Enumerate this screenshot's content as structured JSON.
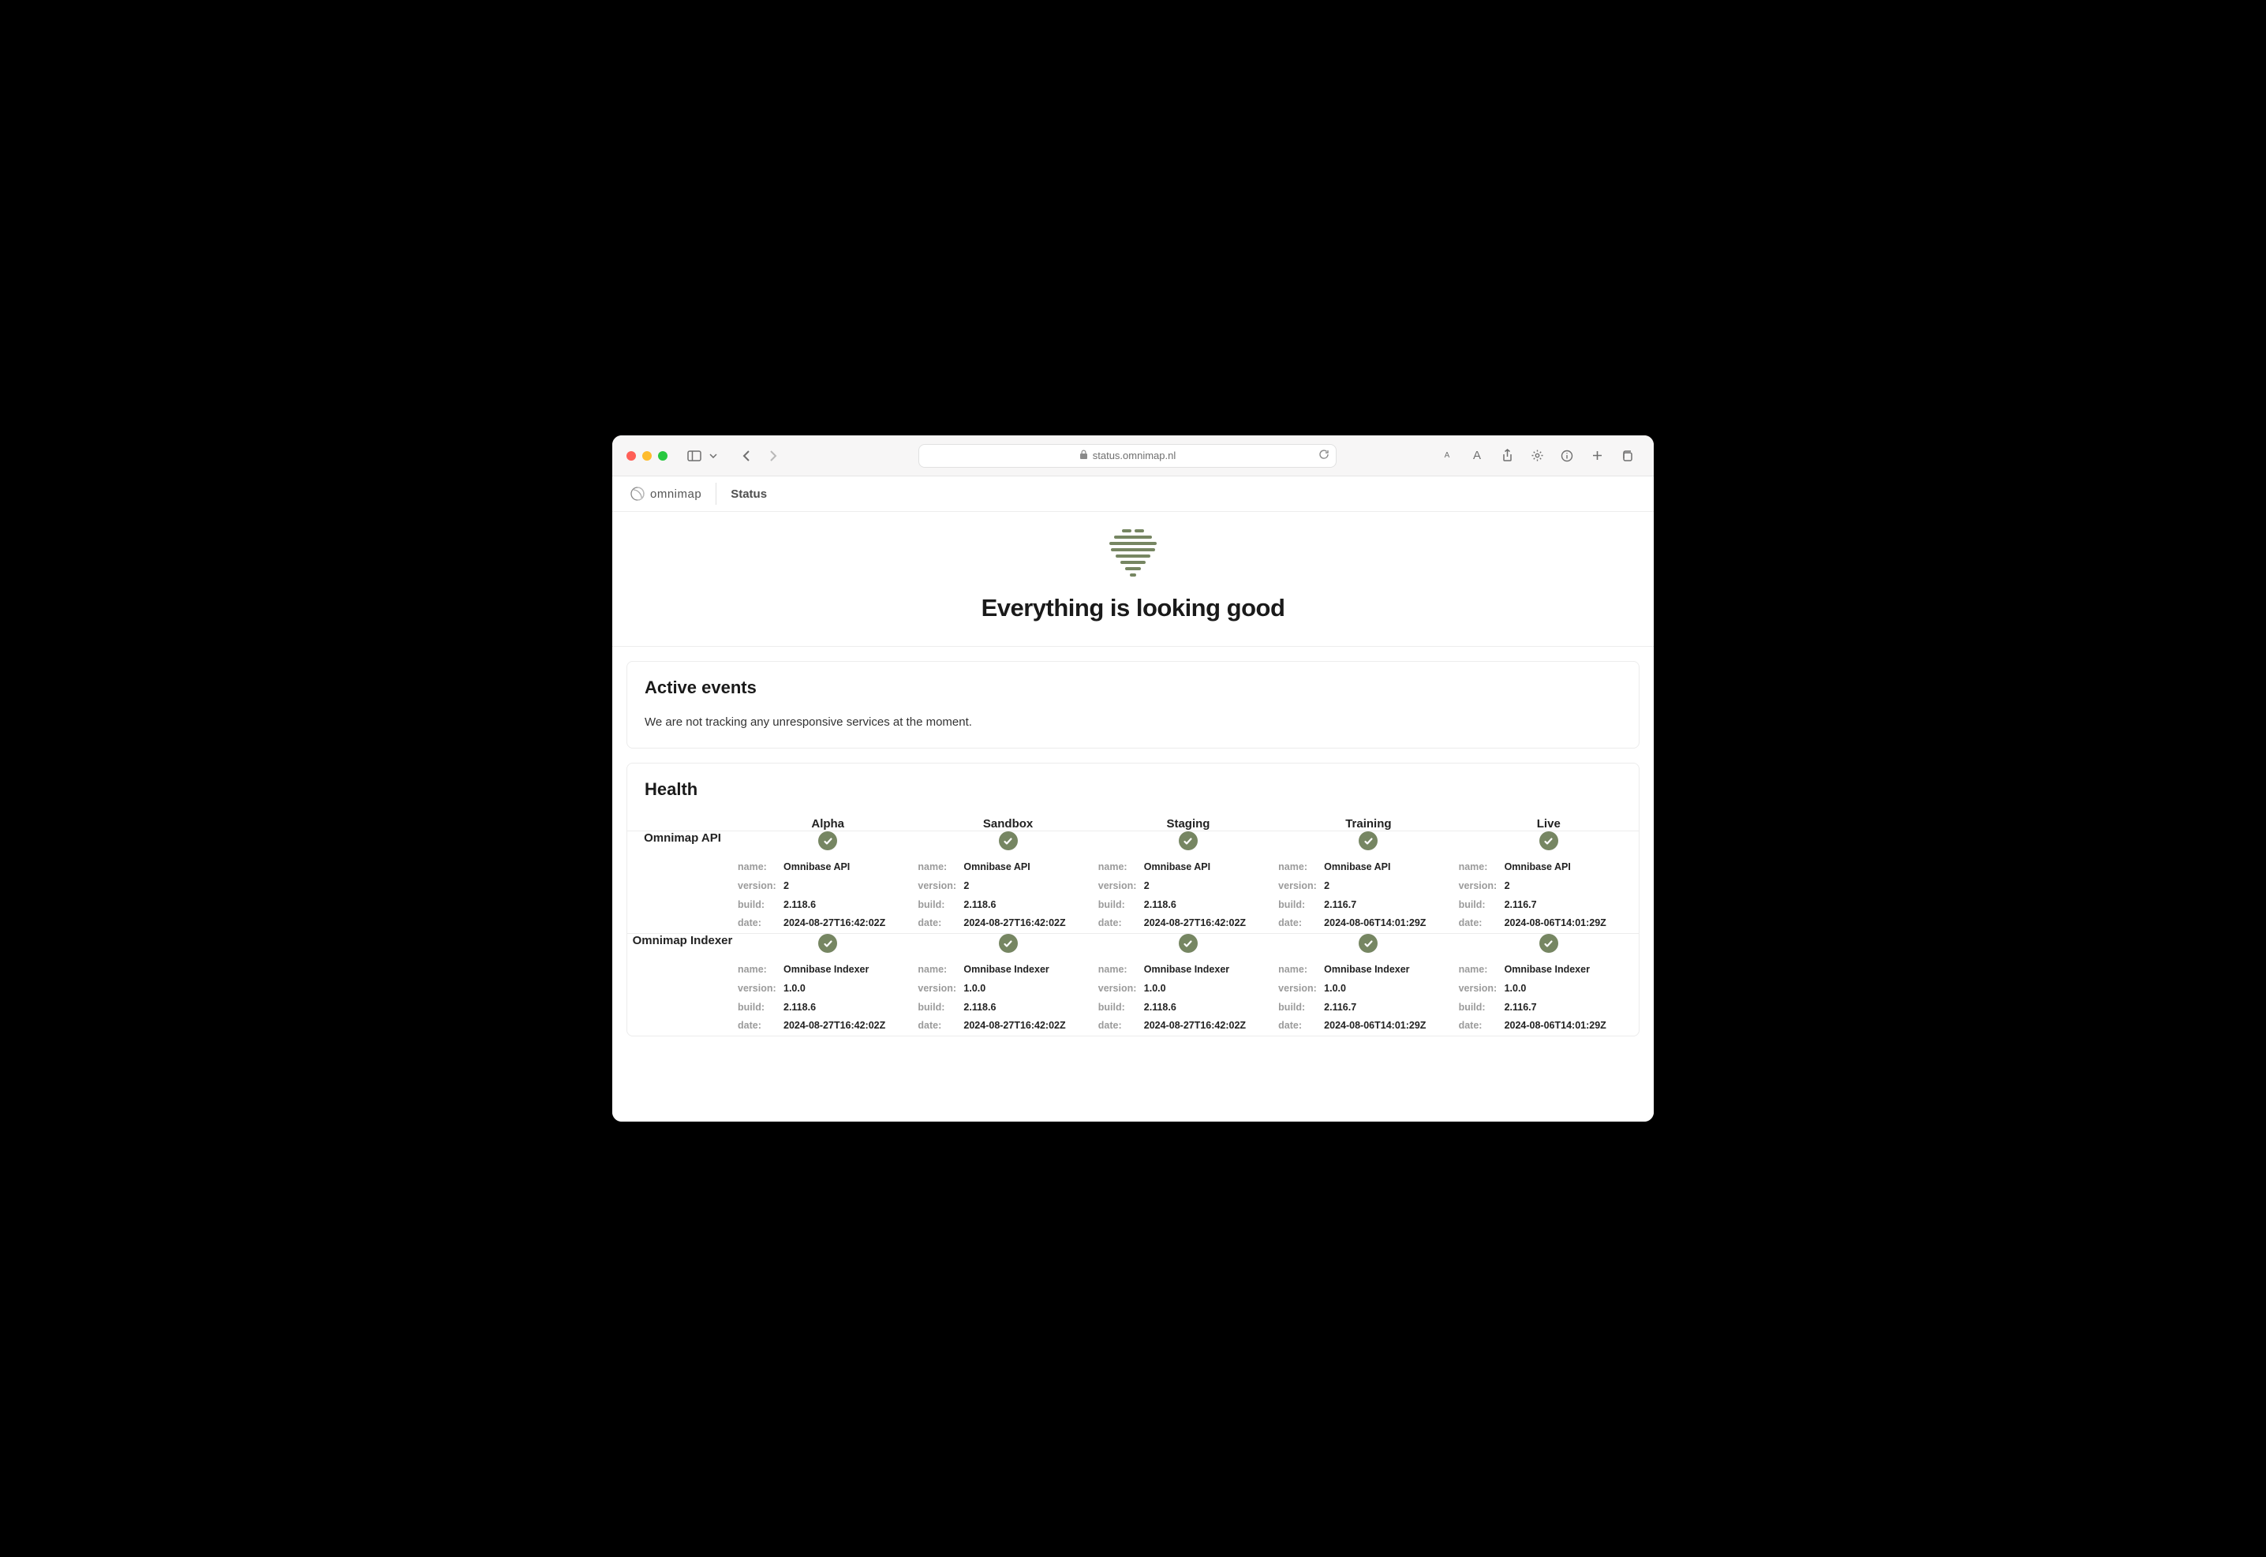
{
  "browser": {
    "url": "status.omnimap.nl"
  },
  "header": {
    "brand": "omnimap",
    "page_label": "Status"
  },
  "hero": {
    "title": "Everything is looking good"
  },
  "active_events": {
    "heading": "Active events",
    "message": "We are not tracking any unresponsive services at the moment."
  },
  "health": {
    "heading": "Health",
    "labels": {
      "name": "name:",
      "version": "version:",
      "build": "build:",
      "date": "date:"
    },
    "environments": [
      "Alpha",
      "Sandbox",
      "Staging",
      "Training",
      "Live"
    ],
    "services": [
      {
        "label": "Omnimap API",
        "cells": [
          {
            "name": "Omnibase API",
            "version": "2",
            "build": "2.118.6",
            "date": "2024-08-27T16:42:02Z"
          },
          {
            "name": "Omnibase API",
            "version": "2",
            "build": "2.118.6",
            "date": "2024-08-27T16:42:02Z"
          },
          {
            "name": "Omnibase API",
            "version": "2",
            "build": "2.118.6",
            "date": "2024-08-27T16:42:02Z"
          },
          {
            "name": "Omnibase API",
            "version": "2",
            "build": "2.116.7",
            "date": "2024-08-06T14:01:29Z"
          },
          {
            "name": "Omnibase API",
            "version": "2",
            "build": "2.116.7",
            "date": "2024-08-06T14:01:29Z"
          }
        ]
      },
      {
        "label": "Omnimap Indexer",
        "cells": [
          {
            "name": "Omnibase Indexer",
            "version": "1.0.0",
            "build": "2.118.6",
            "date": "2024-08-27T16:42:02Z"
          },
          {
            "name": "Omnibase Indexer",
            "version": "1.0.0",
            "build": "2.118.6",
            "date": "2024-08-27T16:42:02Z"
          },
          {
            "name": "Omnibase Indexer",
            "version": "1.0.0",
            "build": "2.118.6",
            "date": "2024-08-27T16:42:02Z"
          },
          {
            "name": "Omnibase Indexer",
            "version": "1.0.0",
            "build": "2.116.7",
            "date": "2024-08-06T14:01:29Z"
          },
          {
            "name": "Omnibase Indexer",
            "version": "1.0.0",
            "build": "2.116.7",
            "date": "2024-08-06T14:01:29Z"
          }
        ]
      }
    ]
  }
}
